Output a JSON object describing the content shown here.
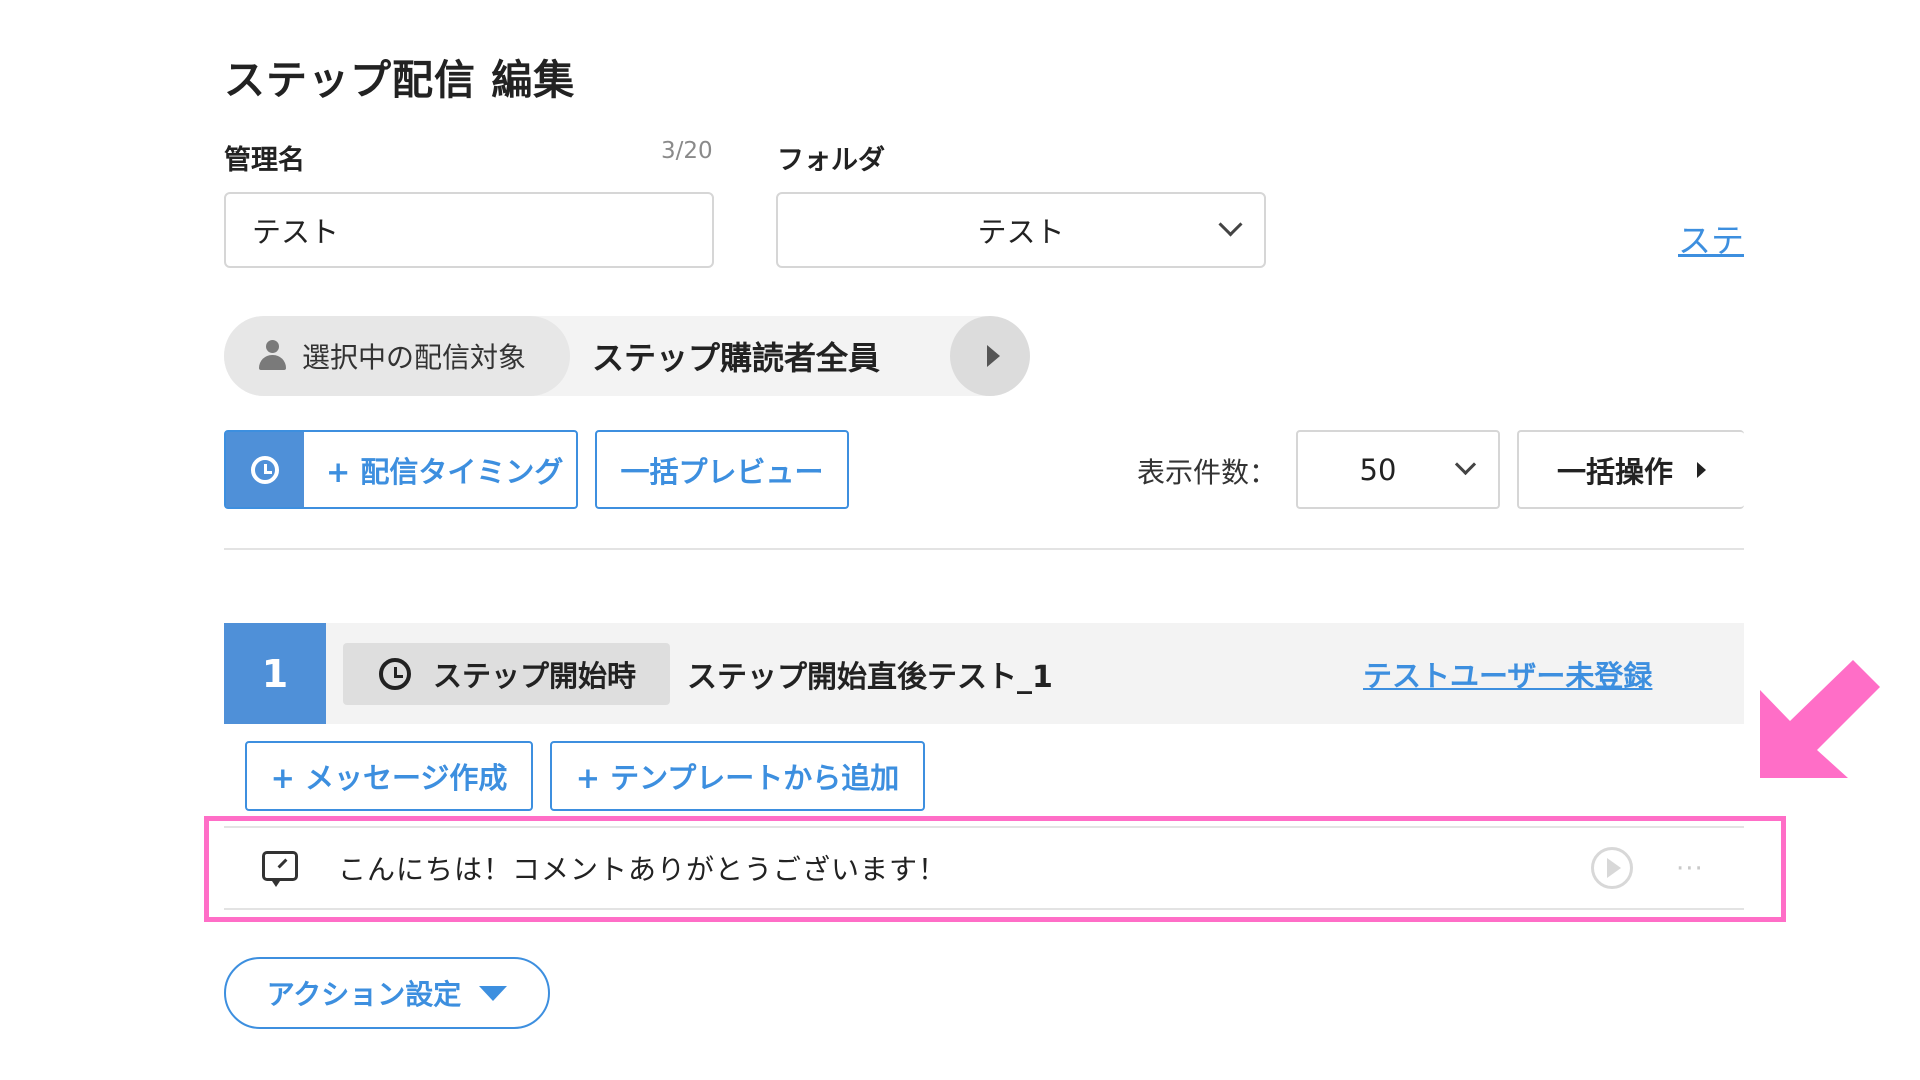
{
  "page": {
    "title": "ステップ配信 編集"
  },
  "form": {
    "name_label": "管理名",
    "name_counter": "3/20",
    "name_value": "テスト",
    "folder_label": "フォルダ",
    "folder_value": "テスト",
    "right_link_partial": "ステ"
  },
  "target": {
    "label": "選択中の配信対象",
    "value": "ステップ購読者全員"
  },
  "toolbar": {
    "timing_button": "+ 配信タイミング",
    "bulk_preview_button": "一括プレビュー",
    "display_count_label": "表示件数：",
    "display_count_value": "50",
    "bulk_operation_button": "一括操作"
  },
  "step": {
    "number": "1",
    "timing_badge": "ステップ開始時",
    "name": "ステップ開始直後テスト_1",
    "test_user_link": "テストユーザー未登録",
    "add_message_button": "+ メッセージ作成",
    "add_template_button": "+ テンプレートから追加"
  },
  "message": {
    "text": "こんにちは！コメントありがとうございます！",
    "more": "···"
  },
  "actions": {
    "action_settings_button": "アクション設定"
  },
  "colors": {
    "accent_blue": "#3d8fdf",
    "step_blue": "#4f90d8",
    "highlight_pink": "#ff6ec7"
  }
}
